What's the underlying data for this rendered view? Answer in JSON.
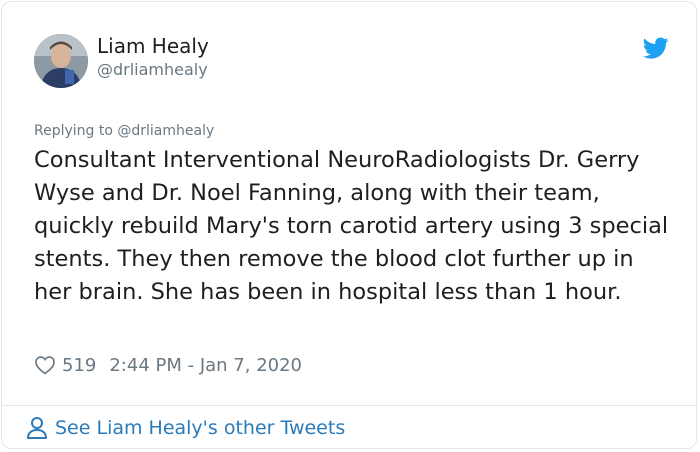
{
  "author": {
    "name": "Liam Healy",
    "handle": "@drliamhealy"
  },
  "reply": {
    "label": "Replying to @drliamhealy"
  },
  "tweet": {
    "text": "Consultant Interventional NeuroRadiologists Dr. Gerry Wyse and Dr. Noel Fanning, along with their team, quickly rebuild Mary's torn carotid artery using 3 special stents. They then remove the blood clot further up in her brain. She has been in hospital less than 1 hour.",
    "likes": "519",
    "timestamp": "2:44 PM - Jan 7, 2020"
  },
  "footer": {
    "see_more_label": "See Liam Healy's other Tweets"
  },
  "colors": {
    "twitter_blue": "#1da1f2",
    "link_blue": "#2b7bb9",
    "secondary_text": "#697882",
    "border": "#e1e8ed"
  },
  "icons": {
    "brand": "twitter-bird-icon",
    "like": "heart-icon",
    "profile": "person-icon"
  }
}
